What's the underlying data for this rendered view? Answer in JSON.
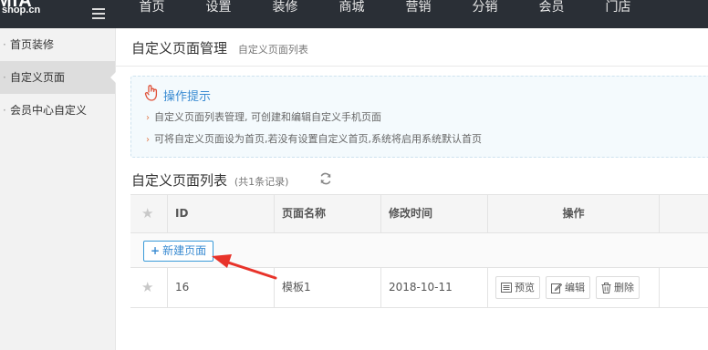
{
  "brand": {
    "logo_top": "MIA",
    "logo_bottom": "shop.cn"
  },
  "nav": {
    "items": [
      "首页",
      "设置",
      "装修",
      "商城",
      "营销",
      "分销",
      "会员",
      "门店"
    ]
  },
  "sidebar": {
    "items": [
      {
        "label": "首页装修",
        "active": false
      },
      {
        "label": "自定义页面",
        "active": true
      },
      {
        "label": "会员中心自定义",
        "active": false
      }
    ]
  },
  "header": {
    "title": "自定义页面管理",
    "subtitle": "自定义页面列表"
  },
  "tips": {
    "title": "操作提示",
    "items": [
      "自定义页面列表管理, 可创建和编辑自定义手机页面",
      "可将自定义页面设为首页,若没有设置自定义首页,系统将启用系统默认首页"
    ]
  },
  "list": {
    "title": "自定义页面列表",
    "count_text": "(共1条记录)"
  },
  "table": {
    "columns": [
      "",
      "ID",
      "页面名称",
      "修改时间",
      "操作"
    ],
    "new_button": "新建页面",
    "rows": [
      {
        "id": "16",
        "name": "模板1",
        "modified": "2018-10-11"
      }
    ],
    "actions": {
      "preview": "预览",
      "edit": "编辑",
      "delete": "删除"
    }
  },
  "colors": {
    "topbar": "#2a2f36",
    "accent": "#3a8bd2",
    "annotation_arrow": "#e8332a"
  }
}
